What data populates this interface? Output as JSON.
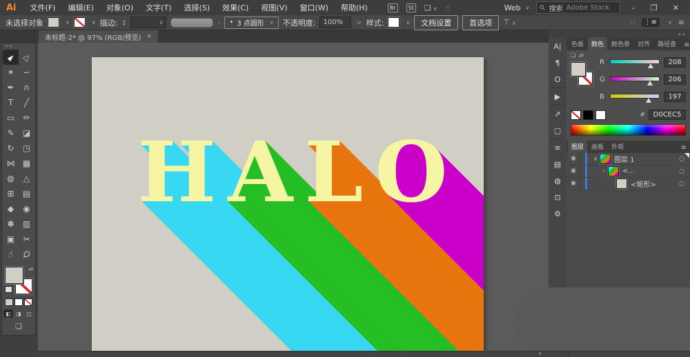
{
  "colors": {
    "accent_blue": "#3E7BDB",
    "artboard": "#D0CEC5",
    "letter_fill": "#F5F5A4",
    "logo_orange": "#F7872E"
  },
  "glyphs": {
    "chevron_down": "∨",
    "menu": "≡",
    "dots": "∷",
    "minimize": "–",
    "restore": "❐",
    "close": "✕",
    "search": "⚲",
    "eye": "◉",
    "target": "○",
    "swap": "⇄",
    "step_up": "▴",
    "step_down": "▾",
    "grip": "••",
    "arrange": "❏",
    "touch": "☝",
    "screen_mode": "❏",
    "status_chevron": "∨",
    "more": ">"
  },
  "menubar": {
    "logo": "Ai",
    "items": [
      {
        "label": "文件(F)"
      },
      {
        "label": "编辑(E)"
      },
      {
        "label": "对象(O)"
      },
      {
        "label": "文字(T)"
      },
      {
        "label": "选择(S)"
      },
      {
        "label": "效果(C)"
      },
      {
        "label": "视图(V)"
      },
      {
        "label": "窗口(W)"
      },
      {
        "label": "帮助(H)"
      }
    ],
    "bridge": "Br",
    "stock": "St",
    "workspace": "Web",
    "search_label": "搜索",
    "search_hint": "Adobe Stock"
  },
  "controlbar": {
    "no_selection": "未选择对象",
    "stroke_label": "描边:",
    "brush_dot": "•",
    "brush_name": "3 点圆形",
    "opacity_label": "不透明度:",
    "opacity_value": "100%",
    "style_label": "样式:",
    "doc_setup": "文档设置",
    "preferences": "首选项"
  },
  "tabbar": {
    "title": "未标题-2* @ 97% (RGB/预览)",
    "close": "×"
  },
  "tools": [
    {
      "name": "selection-tool",
      "glyph": "►",
      "rot": -45,
      "active": true
    },
    {
      "name": "direct-selection-tool",
      "glyph": "▷",
      "rot": -45
    },
    {
      "name": "magic-wand-tool",
      "glyph": "✶"
    },
    {
      "name": "lasso-tool",
      "glyph": "∽"
    },
    {
      "name": "pen-tool",
      "glyph": "✒"
    },
    {
      "name": "curvature-tool",
      "glyph": "∩"
    },
    {
      "name": "type-tool",
      "glyph": "T"
    },
    {
      "name": "line-segment-tool",
      "glyph": "╱"
    },
    {
      "name": "rectangle-tool",
      "glyph": "▭"
    },
    {
      "name": "paintbrush-tool",
      "glyph": "✏"
    },
    {
      "name": "pencil-tool",
      "glyph": "✎"
    },
    {
      "name": "eraser-tool",
      "glyph": "◪"
    },
    {
      "name": "rotate-tool",
      "glyph": "↻"
    },
    {
      "name": "scale-tool",
      "glyph": "◳"
    },
    {
      "name": "width-tool",
      "glyph": "⋈"
    },
    {
      "name": "free-transform-tool",
      "glyph": "▦"
    },
    {
      "name": "shape-builder-tool",
      "glyph": "◍"
    },
    {
      "name": "perspective-grid-tool",
      "glyph": "△"
    },
    {
      "name": "mesh-tool",
      "glyph": "⊞"
    },
    {
      "name": "gradient-tool",
      "glyph": "▤"
    },
    {
      "name": "eyedropper-tool",
      "glyph": "◆"
    },
    {
      "name": "blend-tool",
      "glyph": "◉"
    },
    {
      "name": "symbol-sprayer-tool",
      "glyph": "✽"
    },
    {
      "name": "column-graph-tool",
      "glyph": "▥"
    },
    {
      "name": "artboard-tool",
      "glyph": "▣"
    },
    {
      "name": "slice-tool",
      "glyph": "✂"
    },
    {
      "name": "hand-tool",
      "glyph": "☝"
    },
    {
      "name": "zoom-tool",
      "glyph": "Ϙ",
      "rot": 45
    }
  ],
  "dock_icons": [
    {
      "name": "character-panel-icon",
      "glyph": "A|"
    },
    {
      "name": "paragraph-panel-icon",
      "glyph": "¶"
    },
    {
      "name": "opentype-panel-icon",
      "glyph": "O"
    },
    {
      "name": "actions-panel-icon",
      "glyph": "▶",
      "sep": true
    },
    {
      "name": "export-panel-icon",
      "glyph": "⇗",
      "sep": true
    },
    {
      "name": "transform-panel-icon",
      "glyph": "▢"
    },
    {
      "name": "stroke-panel-icon",
      "glyph": "≡",
      "sep": true
    },
    {
      "name": "gradient-panel-icon",
      "glyph": "▤"
    },
    {
      "name": "transparency-panel-icon",
      "glyph": "◍"
    },
    {
      "name": "links-panel-icon",
      "glyph": "⊡"
    },
    {
      "name": "symbols-panel-icon",
      "glyph": "⚙"
    }
  ],
  "color_panel": {
    "tabs": [
      {
        "label": "色板",
        "active": false
      },
      {
        "label": "颜色",
        "active": true
      },
      {
        "label": "颜色参",
        "active": false
      },
      {
        "label": "对齐",
        "active": false
      },
      {
        "label": "路径查",
        "active": false
      }
    ],
    "sliders": [
      {
        "label": "R",
        "value": "208",
        "track_from": "rgb(0,206,197)",
        "track_to": "rgb(255,206,197)",
        "pct": 81.6
      },
      {
        "label": "G",
        "value": "206",
        "track_from": "rgb(208,0,197)",
        "track_to": "rgb(208,255,197)",
        "pct": 80.8
      },
      {
        "label": "B",
        "value": "197",
        "track_from": "rgb(208,206,0)",
        "track_to": "rgb(208,206,255)",
        "pct": 77.3
      }
    ],
    "hex_label": "#",
    "hex_value": "D0CEC5"
  },
  "layers_panel": {
    "tabs": [
      {
        "label": "图层",
        "active": true
      },
      {
        "label": "画板",
        "active": false
      },
      {
        "label": "外观",
        "active": false
      }
    ],
    "rows": [
      {
        "name": "图层 1",
        "expander": "∨",
        "indent": 6,
        "thumb": "art",
        "corner": true
      },
      {
        "name": "<...",
        "expander": "›",
        "indent": 18,
        "thumb": "art",
        "corner": false
      },
      {
        "name": "<矩形>",
        "expander": "",
        "indent": 30,
        "thumb": "solid",
        "corner": false
      }
    ]
  },
  "canvas": {
    "letter_fill": "#F5F5A4",
    "shadow_steps": 340,
    "letters": [
      {
        "char": "H",
        "shadow": "#38D8F2"
      },
      {
        "char": "A",
        "shadow": "#25BE25"
      },
      {
        "char": "L",
        "shadow": "#E8740F"
      },
      {
        "char": "O",
        "shadow": "#CA00CA"
      }
    ],
    "artboard_hex": "#D0CEC5"
  }
}
